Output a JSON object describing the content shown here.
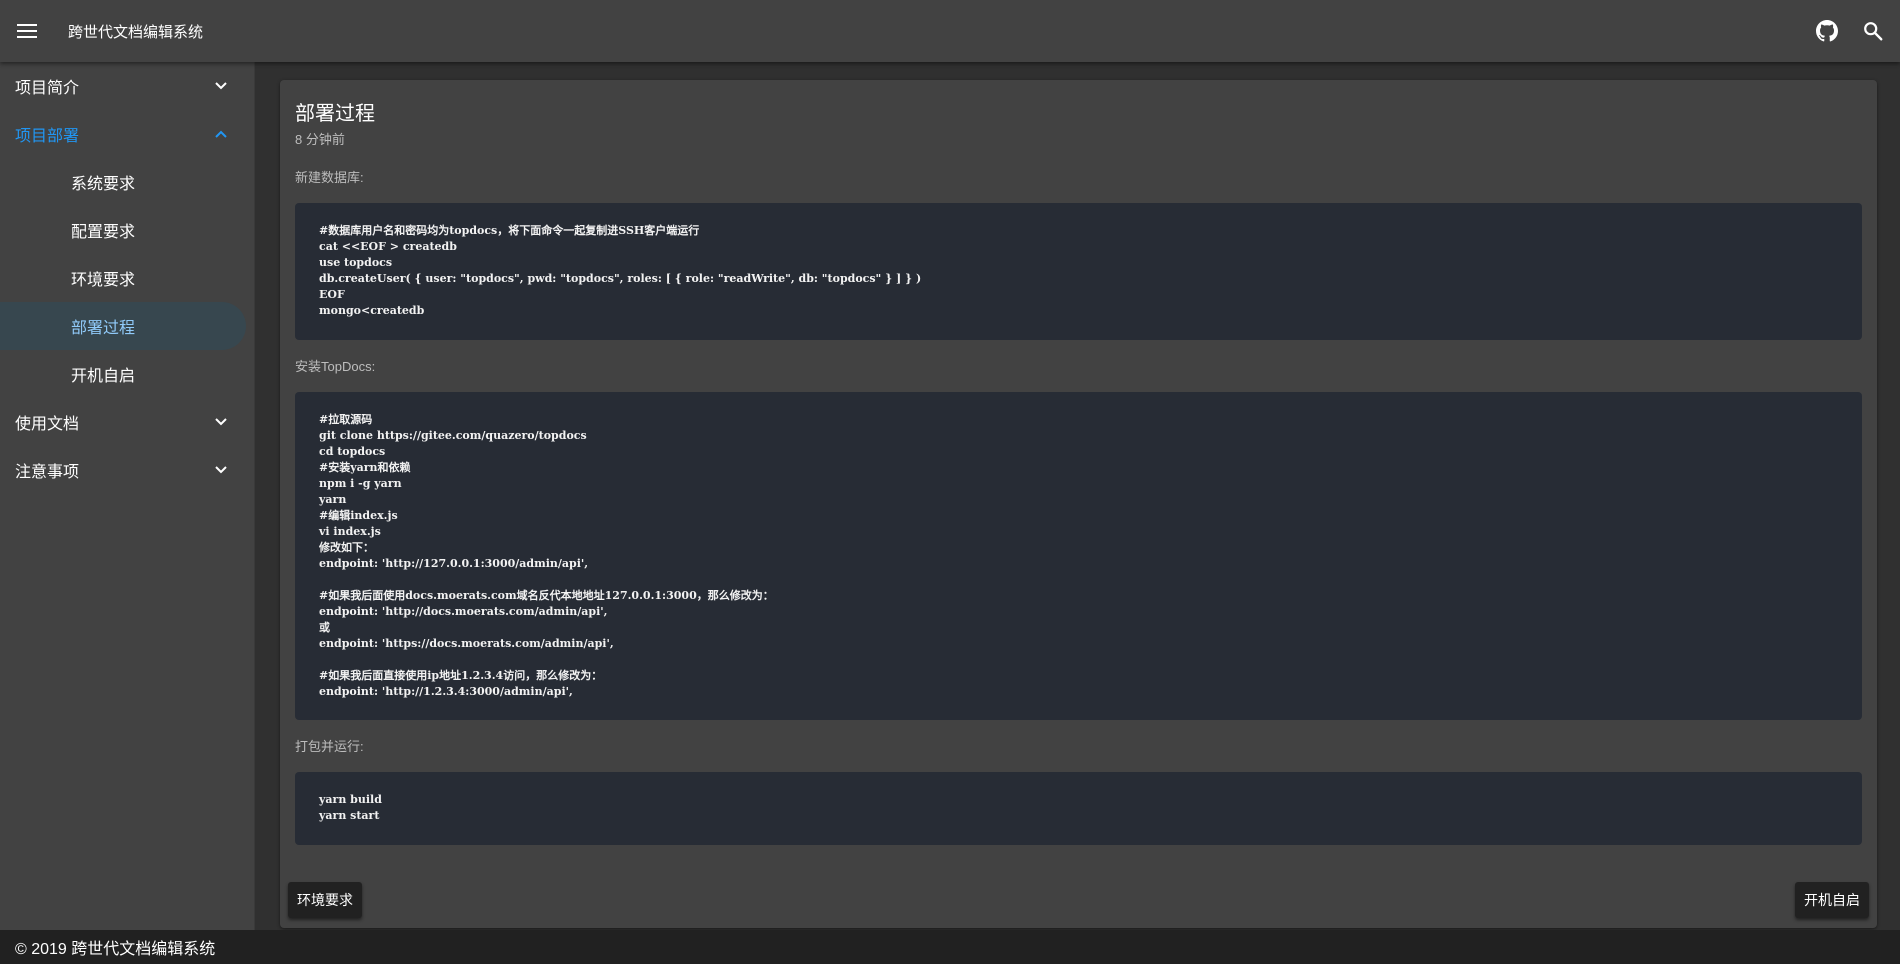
{
  "appbar": {
    "title": "跨世代文档编辑系统",
    "menu_icon": "menu-icon",
    "github_icon": "github-icon",
    "search_icon": "search-icon"
  },
  "sidebar": {
    "groups": [
      {
        "label": "项目简介",
        "expanded": false
      },
      {
        "label": "项目部署",
        "expanded": true,
        "children": [
          "系统要求",
          "配置要求",
          "环境要求",
          "部署过程",
          "开机自启"
        ],
        "selected": "部署过程"
      },
      {
        "label": "使用文档",
        "expanded": false
      },
      {
        "label": "注意事项",
        "expanded": false
      }
    ]
  },
  "page": {
    "title": "部署过程",
    "time": "8 分钟前",
    "sections": [
      {
        "label": "新建数据库:",
        "code": [
          "#数据库用户名和密码均为topdocs，将下面命令一起复制进SSH客户端运行",
          "cat <<EOF > createdb",
          "use topdocs",
          "db.createUser( { user: \"topdocs\", pwd: \"topdocs\", roles: [ { role: \"readWrite\", db: \"topdocs\" } ] } )",
          "EOF",
          "mongo<createdb"
        ]
      },
      {
        "label": "安装TopDocs:",
        "code": [
          "#拉取源码",
          "git clone https://gitee.com/quazero/topdocs",
          "cd topdocs",
          "#安装yarn和依赖",
          "npm i -g yarn",
          "yarn",
          "#编辑index.js",
          "vi index.js",
          "修改如下：",
          "endpoint: 'http://127.0.0.1:3000/admin/api',",
          "",
          "#如果我后面使用docs.moerats.com域名反代本地地址127.0.0.1:3000，那么修改为：",
          "endpoint: 'http://docs.moerats.com/admin/api',",
          "或",
          "endpoint: 'https://docs.moerats.com/admin/api',",
          "",
          "#如果我后面直接使用ip地址1.2.3.4访问，那么修改为：",
          "endpoint: 'http://1.2.3.4:3000/admin/api',"
        ]
      },
      {
        "label": "打包并运行:",
        "code": [
          "yarn build",
          "yarn start"
        ]
      }
    ],
    "prev_label": "环境要求",
    "next_label": "开机自启"
  },
  "footer": {
    "text": "© 2019 跨世代文档编辑系统"
  },
  "colors": {
    "accent": "#2196f3",
    "appbar": "#424242",
    "background": "#303030",
    "code_bg": "#272c35",
    "selected_bg": "#37474f"
  }
}
